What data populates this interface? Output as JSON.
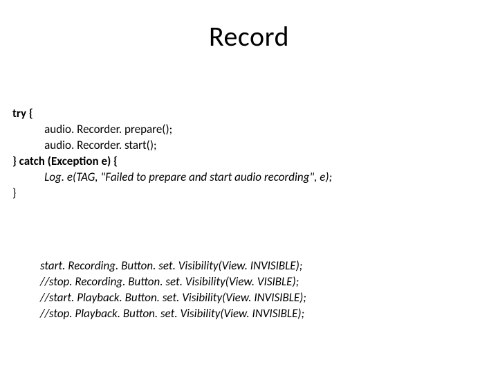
{
  "title": "Record",
  "block1": {
    "l1": "try {",
    "l2": "audio. Recorder. prepare();",
    "l3": "audio. Recorder. start();",
    "l4": "} catch (Exception e) {",
    "l5": "Log. e(TAG, \"Failed to prepare and start audio recording\", e);",
    "l6": "}"
  },
  "block2": {
    "l1": "start. Recording. Button. set. Visibility(View. INVISIBLE);",
    "l2": "//stop. Recording. Button. set. Visibility(View. VISIBLE);",
    "l3": "//start. Playback. Button. set. Visibility(View. INVISIBLE);",
    "l4": "//stop. Playback. Button. set. Visibility(View. INVISIBLE);"
  }
}
